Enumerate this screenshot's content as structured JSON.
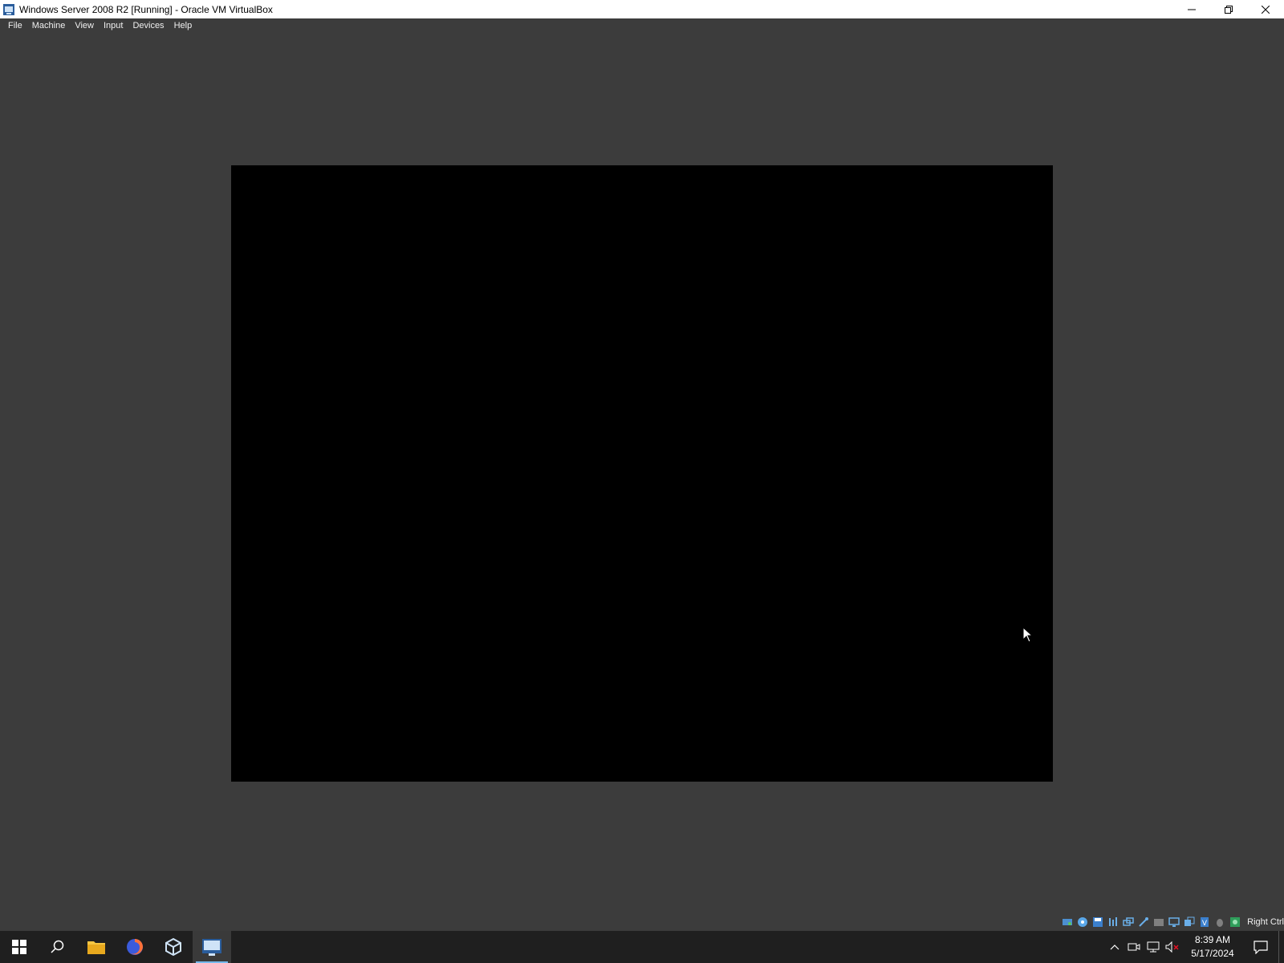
{
  "window": {
    "title": "Windows Server 2008 R2 [Running] - Oracle VM VirtualBox",
    "controls": [
      "minimize-icon",
      "restore-icon",
      "close-icon"
    ]
  },
  "menubar": {
    "items": [
      {
        "label": "File"
      },
      {
        "label": "Machine"
      },
      {
        "label": "View"
      },
      {
        "label": "Input"
      },
      {
        "label": "Devices"
      },
      {
        "label": "Help"
      }
    ]
  },
  "statusbar": {
    "icons": [
      "hard-disk-icon",
      "optical-drive-icon",
      "floppy-icon",
      "audio-icon",
      "network-icon",
      "usb-icon",
      "shared-folders-icon",
      "display-icon",
      "recording-icon",
      "virtualization-icon",
      "mouse-integration-icon",
      "keyboard-icon"
    ],
    "host_key": "Right Ctrl"
  },
  "taskbar": {
    "apps": [
      "start-icon",
      "search-icon",
      "file-explorer-icon",
      "firefox-icon",
      "virtualbox-icon",
      "windows-server-vm-icon"
    ],
    "tray_icons": [
      "chevron-up-icon",
      "meet-now-icon",
      "network-icon",
      "volume-muted-icon"
    ],
    "clock": {
      "time": "8:39 AM",
      "date": "5/17/2024"
    },
    "notification_icon": "action-center-icon"
  },
  "colors": {
    "background": "#3c3c3c",
    "vm_screen": "#000000",
    "taskbar": "#1f1f1f",
    "accent": "#76b9ed"
  }
}
